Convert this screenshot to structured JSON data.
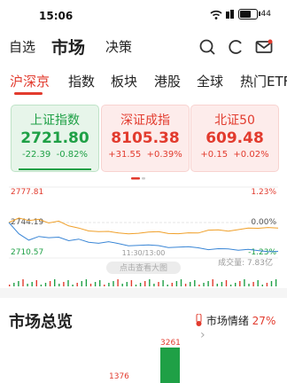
{
  "status_bar": {
    "time": "15:06",
    "battery": "44"
  },
  "header": {
    "tab_watchlist": "自选",
    "tab_market": "市场",
    "tab_decision": "决策"
  },
  "market_tabs": [
    "沪深京",
    "指数",
    "板块",
    "港股",
    "全球",
    "热门ETF"
  ],
  "index_cards": [
    {
      "name": "上证指数",
      "value": "2721.80",
      "change": "-22.39",
      "pct": "-0.82%",
      "direction": "down"
    },
    {
      "name": "深证成指",
      "value": "8105.38",
      "change": "+31.55",
      "pct": "+0.39%",
      "direction": "up"
    },
    {
      "name": "北证50",
      "value": "609.48",
      "change": "+0.15",
      "pct": "+0.02%",
      "direction": "up"
    }
  ],
  "intraday_chart": {
    "high_label": "2777.81",
    "mid_label": "2744.19",
    "low_label": "2710.57",
    "pct_high": "1.23%",
    "pct_mid": "0.00%",
    "pct_low": "-1.23%",
    "time_label": "11:30/13:00",
    "hint": "点击查看大图",
    "volume_label": "成交量: 7.83亿"
  },
  "chart_data": {
    "type": "line",
    "title": "",
    "xlabel": "",
    "ylabel": "",
    "ylim": [
      2710.57,
      2777.81
    ],
    "series": [
      {
        "name": "",
        "color": "#f0a02a",
        "values": [
          2744.2,
          2748.5,
          2746.0,
          2747.2,
          2743.8,
          2745.5,
          2741.0,
          2739.0,
          2736.2,
          2735.5,
          2735.8,
          2734.3,
          2733.5,
          2734.0,
          2735.2,
          2735.6,
          2733.8,
          2733.6,
          2734.4,
          2734.3,
          2737.0,
          2737.2,
          2736.0,
          2737.5,
          2739.0,
          2738.7,
          2739.5,
          2739.0
        ]
      },
      {
        "name": "",
        "color": "#3a86d6",
        "values": [
          2744.2,
          2733.5,
          2727.5,
          2731.0,
          2729.8,
          2730.3,
          2727.0,
          2728.5,
          2725.5,
          2724.5,
          2726.0,
          2724.3,
          2722.2,
          2722.5,
          2723.0,
          2722.3,
          2720.5,
          2720.8,
          2721.3,
          2720.2,
          2718.5,
          2719.4,
          2719.2,
          2718.0,
          2718.8,
          2717.6,
          2716.5,
          2716.9
        ]
      }
    ]
  },
  "overview": {
    "title": "市场总览",
    "sentiment_label": "市场情绪",
    "sentiment_value": "27%",
    "bar_values": [
      "1376",
      "3261"
    ]
  },
  "colors": {
    "up": "#e23b2e",
    "down": "#1fa046",
    "accent": "#e23b2e"
  }
}
